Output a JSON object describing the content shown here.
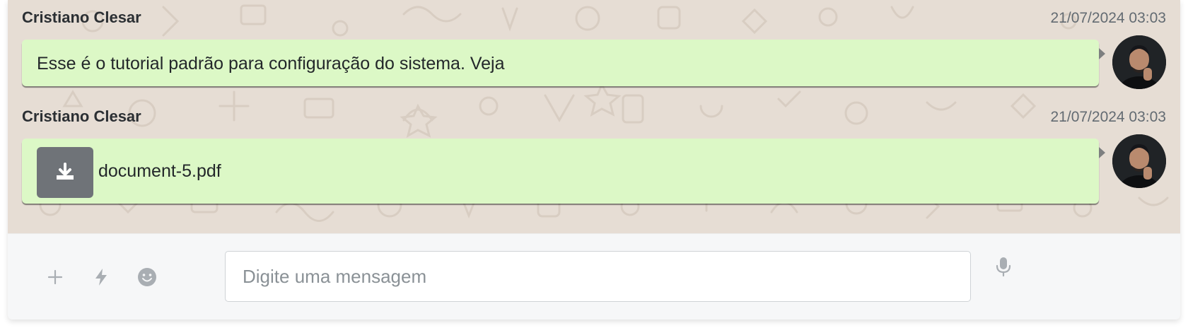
{
  "messages": [
    {
      "sender": "Cristiano Clesar",
      "timestamp": "21/07/2024 03:03",
      "text": "Esse é o tutorial padrão para configuração do sistema. Veja"
    },
    {
      "sender": "Cristiano Clesar",
      "timestamp": "21/07/2024 03:03",
      "file": {
        "name": "document-5.pdf",
        "icon": "download-icon"
      }
    }
  ],
  "composer": {
    "placeholder": "Digite uma mensagem",
    "icons": [
      "plus-icon",
      "bolt-icon",
      "emoji-icon",
      "microphone-icon"
    ]
  },
  "colors": {
    "chat_background": "#e6ddd4",
    "bubble": "#dcf8c6",
    "file_button": "#6f7378",
    "composer_background": "#f6f7f8"
  }
}
